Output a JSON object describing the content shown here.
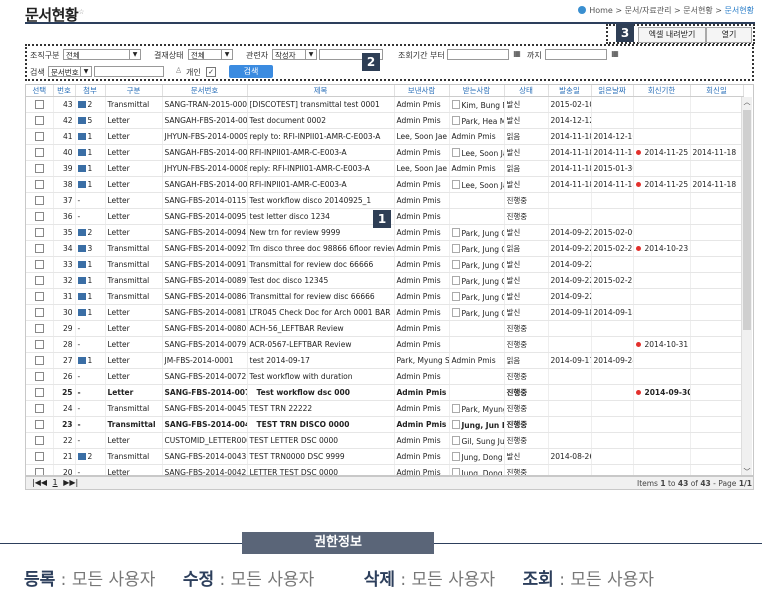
{
  "header": {
    "title": "문서현황",
    "title_sup": "☆",
    "breadcrumb": {
      "home": "Home",
      "sep": ">",
      "level1": "문서/자료관리",
      "level2": "문서현황",
      "current": "문서현황"
    }
  },
  "toolbar": {
    "excel_label": "엑셀 내려받기",
    "open_label": "열기"
  },
  "callouts": {
    "grid": "1",
    "filter": "2",
    "toolbar": "3"
  },
  "filter": {
    "org_label": "조직구분",
    "org_value": "전체",
    "approval_label": "결재상태",
    "approval_value": "전체",
    "related_label": "관련자",
    "related_value": "작성자",
    "period_from_label": "조회기간 부터",
    "period_to_label": "까지",
    "search_label": "검색",
    "search_field_value": "문서번호",
    "personal_label": "개인",
    "search_button": "검색"
  },
  "table": {
    "columns": [
      "선택",
      "번호",
      "첨부",
      "구분",
      "문서번호",
      "제목",
      "보낸사람",
      "받는사람",
      "상태",
      "발송일",
      "읽은날짜",
      "회신기한",
      "회신일"
    ],
    "rows": [
      {
        "no": "43",
        "att": "2",
        "type": "Transmittal",
        "docno": "SANG-TRAN-2015-0001",
        "title": "[DISCOTEST] transmittal test 0001",
        "sender": "Admin Pmis",
        "receiver": "Kim, Bung Mi",
        "status": "발신",
        "sent": "2015-02-10",
        "read": "",
        "due": "",
        "reply": "",
        "bold": false,
        "isnew": false,
        "reddot": false
      },
      {
        "no": "42",
        "att": "5",
        "type": "Letter",
        "docno": "SANGAH-FBS-2014-0009",
        "title": "Test document 0002",
        "sender": "Admin Pmis",
        "receiver": "Park, Hea Mi",
        "status": "발신",
        "sent": "2014-12-12",
        "read": "",
        "due": "",
        "reply": "",
        "bold": false,
        "isnew": false,
        "reddot": false
      },
      {
        "no": "41",
        "att": "1",
        "type": "Letter",
        "docno": "JHYUN-FBS-2014-0009",
        "title": "reply to: RFI-INPII01-AMR-C-E003-A",
        "sender": "Lee, Soon Jae",
        "receiver": "Admin Pmis",
        "status": "읽음",
        "sent": "2014-11-18",
        "read": "2014-12-16",
        "due": "",
        "reply": "",
        "bold": false,
        "isnew": false,
        "reddot": false
      },
      {
        "no": "40",
        "att": "1",
        "type": "Letter",
        "docno": "SANGAH-FBS-2014-0008",
        "title": "RFI-INPII01-AMR-C-E003-A",
        "sender": "Admin Pmis",
        "receiver": "Lee, Soon Jae",
        "status": "발신",
        "sent": "2014-11-18",
        "read": "2014-11-18",
        "due": "2014-11-25",
        "reply": "2014-11-18",
        "bold": false,
        "isnew": false,
        "reddot": true
      },
      {
        "no": "39",
        "att": "1",
        "type": "Letter",
        "docno": "JHYUN-FBS-2014-0008",
        "title": "reply: RFI-INPII01-AMR-C-E003-A",
        "sender": "Lee, Soon Jae",
        "receiver": "Admin Pmis",
        "status": "읽음",
        "sent": "2014-11-18",
        "read": "2015-01-30",
        "due": "",
        "reply": "",
        "bold": false,
        "isnew": false,
        "reddot": false
      },
      {
        "no": "38",
        "att": "1",
        "type": "Letter",
        "docno": "SANGAH-FBS-2014-0007",
        "title": "RFI-INPII01-AMR-C-E003-A",
        "sender": "Admin Pmis",
        "receiver": "Lee, Soon Jae",
        "status": "발신",
        "sent": "2014-11-18",
        "read": "2014-11-18",
        "due": "2014-11-25",
        "reply": "2014-11-18",
        "bold": false,
        "isnew": false,
        "reddot": true
      },
      {
        "no": "37",
        "att": "-",
        "type": "Letter",
        "docno": "SANG-FBS-2014-0115",
        "title": "Test workflow disco 20140925_1",
        "sender": "Admin Pmis",
        "receiver": "",
        "status": "진행중",
        "sent": "",
        "read": "",
        "due": "",
        "reply": "",
        "bold": false,
        "isnew": false,
        "reddot": false
      },
      {
        "no": "36",
        "att": "-",
        "type": "Letter",
        "docno": "SANG-FBS-2014-0095",
        "title": "test letter disco 1234",
        "sender": "Admin Pmis",
        "receiver": "",
        "status": "진행중",
        "sent": "",
        "read": "",
        "due": "",
        "reply": "",
        "bold": false,
        "isnew": false,
        "reddot": false
      },
      {
        "no": "35",
        "att": "2",
        "type": "Letter",
        "docno": "SANG-FBS-2014-0094",
        "title": "New trn for review 9999",
        "sender": "Admin Pmis",
        "receiver": "Park, Jung Ci",
        "status": "발신",
        "sent": "2014-09-22",
        "read": "2015-02-09",
        "due": "",
        "reply": "",
        "bold": false,
        "isnew": false,
        "reddot": false
      },
      {
        "no": "34",
        "att": "3",
        "type": "Transmittal",
        "docno": "SANG-FBS-2014-0092",
        "title": "Trn disco three doc 98866 6floor review",
        "sender": "Admin Pmis",
        "receiver": "Park, Jung Ci",
        "status": "읽음",
        "sent": "2014-09-22",
        "read": "2015-02-27",
        "due": "2014-10-23",
        "reply": "",
        "bold": false,
        "isnew": false,
        "reddot": true
      },
      {
        "no": "33",
        "att": "1",
        "type": "Transmittal",
        "docno": "SANG-FBS-2014-0091",
        "title": "Transmittal for review doc 66666",
        "sender": "Admin Pmis",
        "receiver": "Park, Jung Ci",
        "status": "발신",
        "sent": "2014-09-22",
        "read": "",
        "due": "",
        "reply": "",
        "bold": false,
        "isnew": false,
        "reddot": false
      },
      {
        "no": "32",
        "att": "1",
        "type": "Transmittal",
        "docno": "SANG-FBS-2014-0089",
        "title": "Test doc disco 12345",
        "sender": "Admin Pmis",
        "receiver": "Park, Jung Ci",
        "status": "발신",
        "sent": "2014-09-22",
        "read": "2015-02-27",
        "due": "",
        "reply": "",
        "bold": false,
        "isnew": false,
        "reddot": false
      },
      {
        "no": "31",
        "att": "1",
        "type": "Transmittal",
        "docno": "SANG-FBS-2014-0086",
        "title": "Transmittal for review disc 66666",
        "sender": "Admin Pmis",
        "receiver": "Park, Jung Ci",
        "status": "발신",
        "sent": "2014-09-22",
        "read": "",
        "due": "",
        "reply": "",
        "bold": false,
        "isnew": false,
        "reddot": false
      },
      {
        "no": "30",
        "att": "1",
        "type": "Letter",
        "docno": "SANG-FBS-2014-0081",
        "title": "LTR045 Check Doc for Arch 0001 BAR",
        "sender": "Admin Pmis",
        "receiver": "Park, Jung Ci",
        "status": "발신",
        "sent": "2014-09-18",
        "read": "2014-09-18",
        "due": "",
        "reply": "",
        "bold": false,
        "isnew": false,
        "reddot": false
      },
      {
        "no": "29",
        "att": "-",
        "type": "Letter",
        "docno": "SANG-FBS-2014-0080",
        "title": "ACH-56_LEFTBAR Review",
        "sender": "Admin Pmis",
        "receiver": "",
        "status": "진행중",
        "sent": "",
        "read": "",
        "due": "",
        "reply": "",
        "bold": false,
        "isnew": false,
        "reddot": false
      },
      {
        "no": "28",
        "att": "-",
        "type": "Letter",
        "docno": "SANG-FBS-2014-0079",
        "title": "ACR-0567-LEFTBAR Review",
        "sender": "Admin Pmis",
        "receiver": "",
        "status": "진행중",
        "sent": "",
        "read": "",
        "due": "2014-10-31",
        "reply": "",
        "bold": false,
        "isnew": false,
        "reddot": true
      },
      {
        "no": "27",
        "att": "1",
        "type": "Letter",
        "docno": "JM-FBS-2014-0001",
        "title": "test 2014-09-17",
        "sender": "Park, Myung Su",
        "receiver": "Admin Pmis",
        "status": "읽음",
        "sent": "2014-09-17",
        "read": "2014-09-24",
        "due": "",
        "reply": "",
        "bold": false,
        "isnew": false,
        "reddot": false
      },
      {
        "no": "26",
        "att": "-",
        "type": "Letter",
        "docno": "SANG-FBS-2014-0072",
        "title": "Test workflow with duration",
        "sender": "Admin Pmis",
        "receiver": "",
        "status": "진행중",
        "sent": "",
        "read": "",
        "due": "",
        "reply": "",
        "bold": false,
        "isnew": false,
        "reddot": false
      },
      {
        "no": "25",
        "att": "-",
        "type": "Letter",
        "docno": "SANG-FBS-2014-0071",
        "title": "Test workflow dsc 000",
        "sender": "Admin Pmis",
        "receiver": "",
        "status": "진행중",
        "sent": "",
        "read": "",
        "due": "2014-09-30",
        "reply": "",
        "bold": true,
        "isnew": true,
        "reddot": true
      },
      {
        "no": "24",
        "att": "-",
        "type": "Transmittal",
        "docno": "SANG-FBS-2014-0045",
        "title": "TEST TRN 22222",
        "sender": "Admin Pmis",
        "receiver": "Park, Myung",
        "status": "진행중",
        "sent": "",
        "read": "",
        "due": "",
        "reply": "",
        "bold": false,
        "isnew": false,
        "reddot": false
      },
      {
        "no": "23",
        "att": "-",
        "type": "Transmittal",
        "docno": "SANG-FBS-2014-0044",
        "title": "TEST TRN DISCO 0000",
        "sender": "Admin Pmis",
        "receiver": "Jung, Jun Ha",
        "status": "진행중",
        "sent": "",
        "read": "",
        "due": "",
        "reply": "",
        "bold": true,
        "isnew": true,
        "reddot": false
      },
      {
        "no": "22",
        "att": "-",
        "type": "Letter",
        "docno": "CUSTOMID_LETTER000",
        "title": "TEST LETTER DSC 0000",
        "sender": "Admin Pmis",
        "receiver": "Gil, Sung Jun",
        "status": "진행중",
        "sent": "",
        "read": "",
        "due": "",
        "reply": "",
        "bold": false,
        "isnew": false,
        "reddot": false
      },
      {
        "no": "21",
        "att": "2",
        "type": "Transmittal",
        "docno": "SANG-FBS-2014-0043",
        "title": "TEST TRN0000 DSC 9999",
        "sender": "Admin Pmis",
        "receiver": "Jung, Dong M",
        "status": "발신",
        "sent": "2014-08-26",
        "read": "",
        "due": "",
        "reply": "",
        "bold": false,
        "isnew": false,
        "reddot": false
      },
      {
        "no": "20",
        "att": "-",
        "type": "Letter",
        "docno": "SANG-FBS-2014-0042",
        "title": "LETTER TEST DSC 0000",
        "sender": "Admin Pmis",
        "receiver": "Jung, Dong M",
        "status": "진행중",
        "sent": "",
        "read": "",
        "due": "",
        "reply": "",
        "bold": false,
        "isnew": false,
        "reddot": false
      },
      {
        "no": "19",
        "att": "-",
        "type": "Letter",
        "docno": "SANG-FBS-2014-0041",
        "title": "TEST DCS LETTER 00000",
        "sender": "Admin Pmis",
        "receiver": "Park, Jung Ci",
        "status": "진행중",
        "sent": "",
        "read": "",
        "due": "",
        "reply": "",
        "bold": false,
        "isnew": false,
        "reddot": false
      }
    ]
  },
  "pager": {
    "first": "|◀◀",
    "page": "1",
    "last": "▶▶|",
    "items_prefix": "Items",
    "items_from": "1",
    "items_to_word": "to",
    "items_to": "43",
    "items_of": "of",
    "items_total": "43",
    "page_label": "- Page",
    "page_current": "1/1"
  },
  "permissions": {
    "title": "권한정보",
    "register_label": "등록",
    "register_value": "모든 사용자",
    "edit_label": "수정",
    "edit_value": "모든 사용자",
    "delete_label": "삭제",
    "delete_value": "모든 사용자",
    "view_label": "조회",
    "view_value": "모든 사용자"
  },
  "colors": {
    "accent": "#2a6fb8",
    "header_rule": "#2d3f5c",
    "search_button": "#3b8be0",
    "due_dot": "#e3302c"
  }
}
